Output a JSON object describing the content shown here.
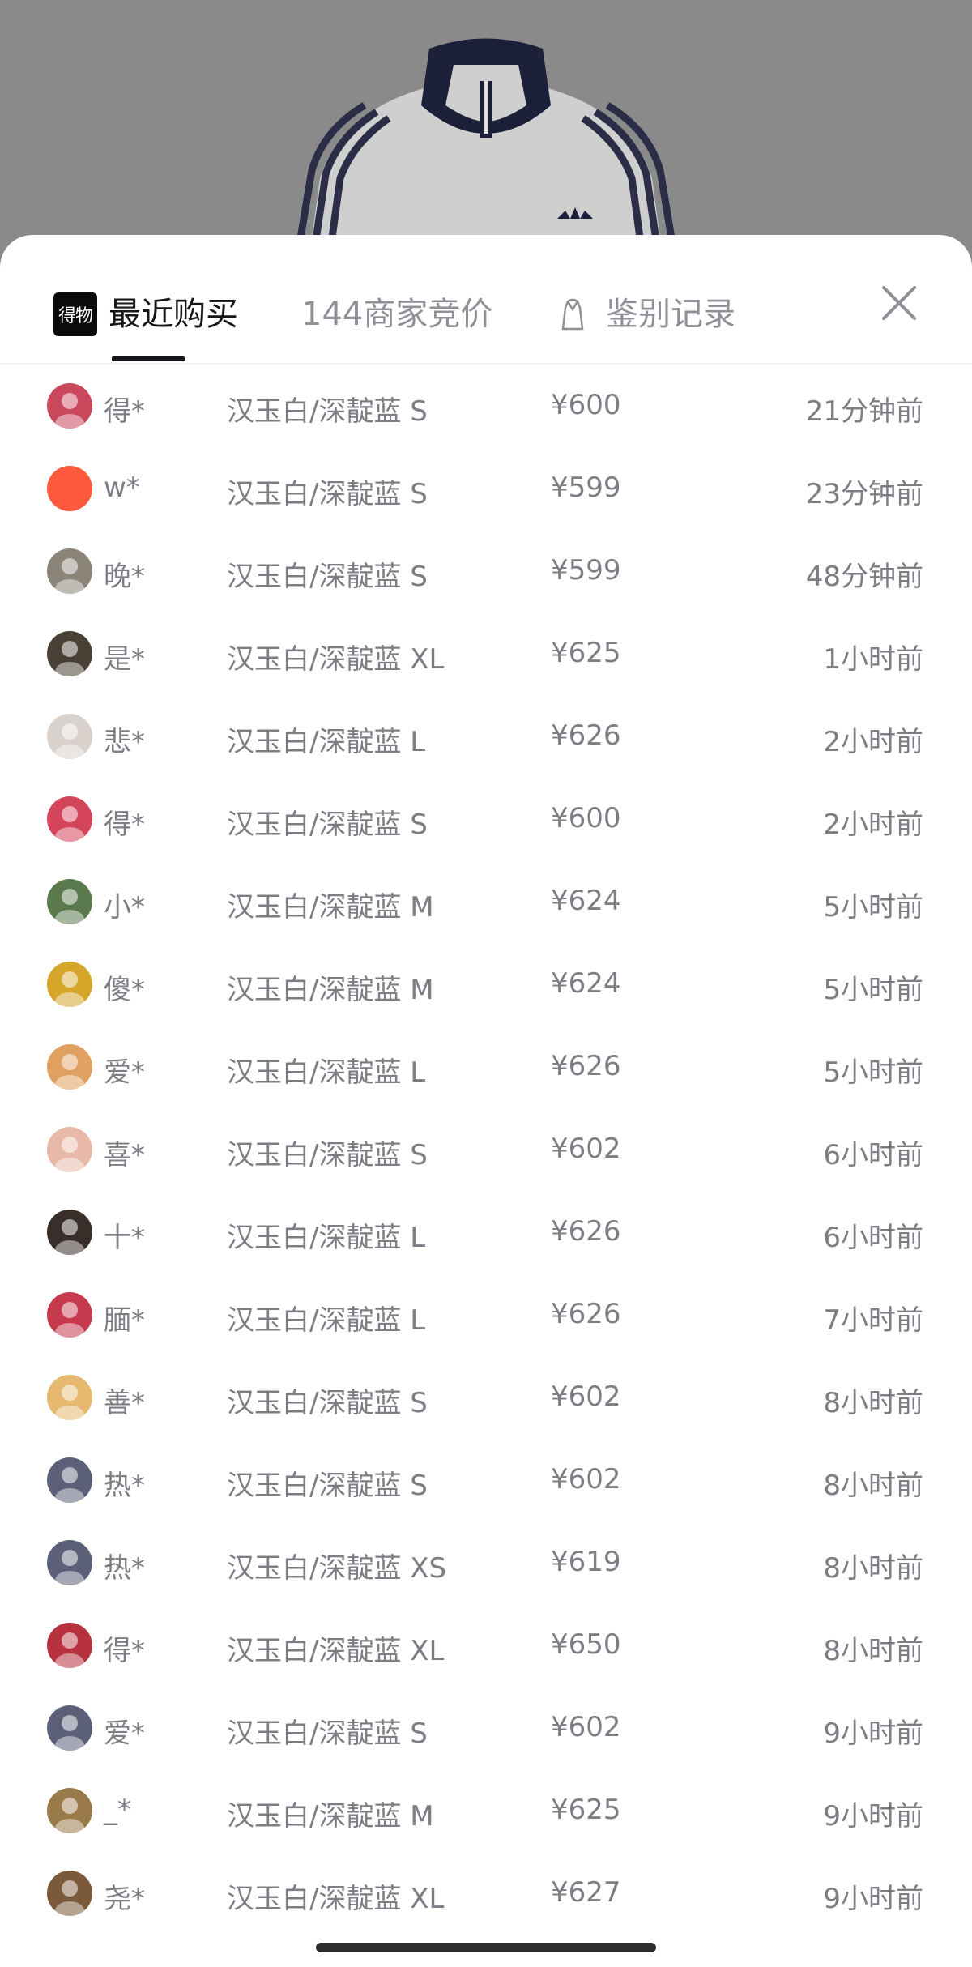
{
  "tabs": {
    "recent": "最近购买",
    "bids": "144商家竞价",
    "auth": "鉴别记录",
    "logo_text": "得物"
  },
  "icons": {
    "close": "close-icon",
    "logo": "poizon-logo-icon",
    "gown": "gown-icon"
  },
  "colors": {
    "text_primary": "#16161a",
    "text_secondary": "#7d7d85",
    "overlay": "#8a8a8a"
  },
  "purchases": [
    {
      "user": "得*",
      "spec": "汉玉白/深靛蓝 S",
      "price": "¥600",
      "time": "21分钟前",
      "avatar": "#c9485b"
    },
    {
      "user": "w*",
      "spec": "汉玉白/深靛蓝 S",
      "price": "¥599",
      "time": "23分钟前",
      "avatar": "#ff5a3c"
    },
    {
      "user": "晚*",
      "spec": "汉玉白/深靛蓝 S",
      "price": "¥599",
      "time": "48分钟前",
      "avatar": "#8b8478"
    },
    {
      "user": "是*",
      "spec": "汉玉白/深靛蓝 XL",
      "price": "¥625",
      "time": "1小时前",
      "avatar": "#4b4036"
    },
    {
      "user": "悲*",
      "spec": "汉玉白/深靛蓝 L",
      "price": "¥626",
      "time": "2小时前",
      "avatar": "#d9d2cc"
    },
    {
      "user": "得*",
      "spec": "汉玉白/深靛蓝 S",
      "price": "¥600",
      "time": "2小时前",
      "avatar": "#d4445a"
    },
    {
      "user": "小*",
      "spec": "汉玉白/深靛蓝 M",
      "price": "¥624",
      "time": "5小时前",
      "avatar": "#5a7a4e"
    },
    {
      "user": "傻*",
      "spec": "汉玉白/深靛蓝 M",
      "price": "¥624",
      "time": "5小时前",
      "avatar": "#d6a62a"
    },
    {
      "user": "爱*",
      "spec": "汉玉白/深靛蓝 L",
      "price": "¥626",
      "time": "5小时前",
      "avatar": "#e0a060"
    },
    {
      "user": "喜*",
      "spec": "汉玉白/深靛蓝 S",
      "price": "¥602",
      "time": "6小时前",
      "avatar": "#e8b8a8"
    },
    {
      "user": "十*",
      "spec": "汉玉白/深靛蓝 L",
      "price": "¥626",
      "time": "6小时前",
      "avatar": "#3a2e2a"
    },
    {
      "user": "腼*",
      "spec": "汉玉白/深靛蓝 L",
      "price": "¥626",
      "time": "7小时前",
      "avatar": "#c73a4e"
    },
    {
      "user": "善*",
      "spec": "汉玉白/深靛蓝 S",
      "price": "¥602",
      "time": "8小时前",
      "avatar": "#e6b870"
    },
    {
      "user": "热*",
      "spec": "汉玉白/深靛蓝 S",
      "price": "¥602",
      "time": "8小时前",
      "avatar": "#5c5f78"
    },
    {
      "user": "热*",
      "spec": "汉玉白/深靛蓝 XS",
      "price": "¥619",
      "time": "8小时前",
      "avatar": "#5c5f78"
    },
    {
      "user": "得*",
      "spec": "汉玉白/深靛蓝 XL",
      "price": "¥650",
      "time": "8小时前",
      "avatar": "#b8313f"
    },
    {
      "user": "爱*",
      "spec": "汉玉白/深靛蓝 S",
      "price": "¥602",
      "time": "9小时前",
      "avatar": "#5c5f78"
    },
    {
      "user": "_*",
      "spec": "汉玉白/深靛蓝 M",
      "price": "¥625",
      "time": "9小时前",
      "avatar": "#9a7a4a"
    },
    {
      "user": "尧*",
      "spec": "汉玉白/深靛蓝 XL",
      "price": "¥627",
      "time": "9小时前",
      "avatar": "#7a5a3a"
    }
  ]
}
